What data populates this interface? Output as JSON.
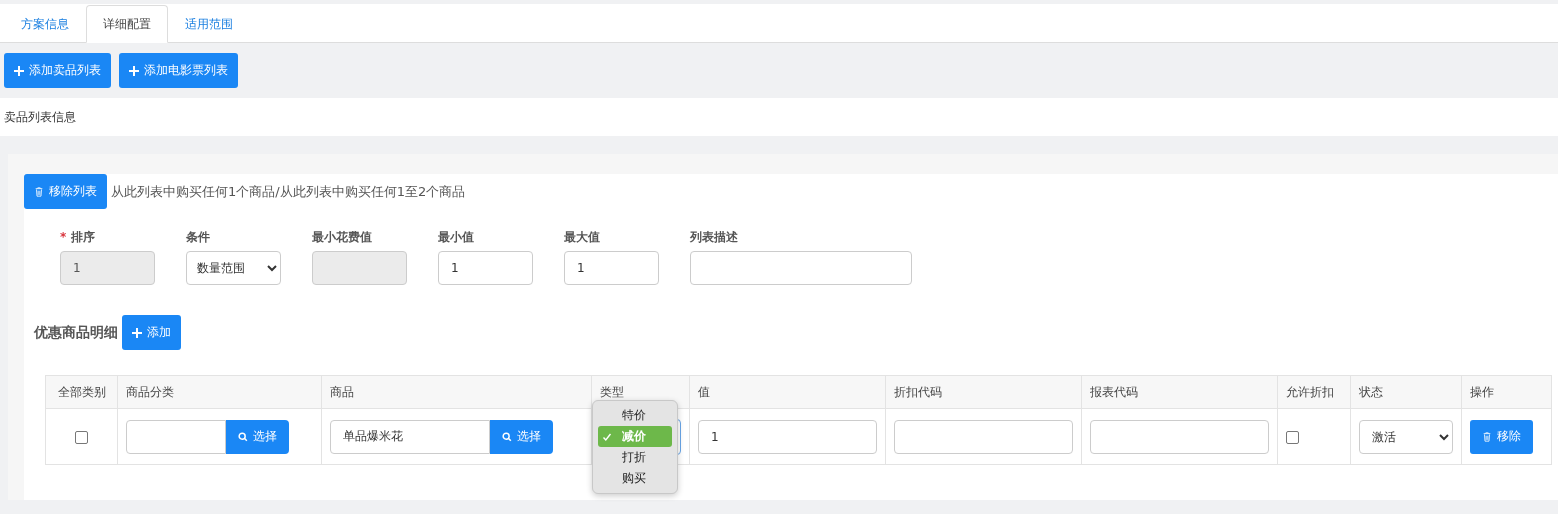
{
  "tabs": [
    {
      "label": "方案信息",
      "selected": false
    },
    {
      "label": "详细配置",
      "selected": true
    },
    {
      "label": "适用范围",
      "selected": false
    }
  ],
  "actions": [
    {
      "label": "添加卖品列表"
    },
    {
      "label": "添加电影票列表"
    }
  ],
  "section_title": "卖品列表信息",
  "list_panel": {
    "remove_button": "移除列表",
    "summary": "从此列表中购买任何1个商品/从此列表中购买任何1至2个商品",
    "fields": [
      {
        "mark": "*",
        "label": "排序",
        "kind": "input",
        "value": "1",
        "disabled": true
      },
      {
        "label": "条件",
        "kind": "select",
        "value": "数量范围"
      },
      {
        "label": "最小花费值",
        "kind": "input",
        "disabled": true
      },
      {
        "label": "最小值",
        "kind": "input",
        "value": "1",
        "disabled": false
      },
      {
        "label": "最大值",
        "kind": "input",
        "value": "1",
        "disabled": false
      },
      {
        "label": "列表描述",
        "kind": "input",
        "disabled": false
      }
    ],
    "detail_title": "优惠商品明细",
    "add_button": "添加",
    "table": {
      "columns": [
        "全部类别",
        "商品分类",
        "商品",
        "类型",
        "值",
        "折扣代码",
        "报表代码",
        "允许折扣",
        "状态",
        "操作"
      ],
      "rows": [
        {
          "all_categories": false,
          "category": "",
          "category_button": "选择",
          "product": "单品爆米花",
          "product_button": "选择",
          "type_options": [
            {
              "label": "特价",
              "selected": false
            },
            {
              "label": "减价",
              "selected": true
            },
            {
              "label": "打折",
              "selected": false
            },
            {
              "label": "购买",
              "selected": false
            }
          ],
          "value": "1",
          "allow_discount": false,
          "status": "激活",
          "remove_button": "移除"
        }
      ]
    }
  }
}
